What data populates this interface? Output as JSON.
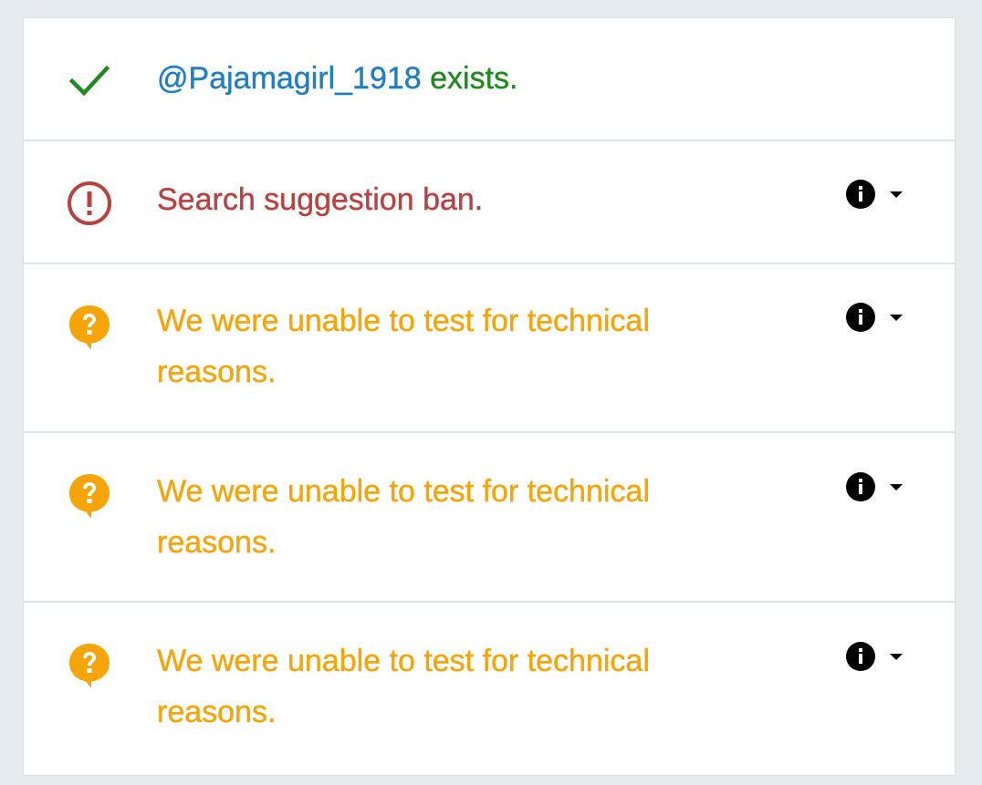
{
  "colors": {
    "success": "#1f8a1f",
    "handle": "#1f7fc0",
    "error": "#b94141",
    "warning": "#f5a40a"
  },
  "rows": [
    {
      "status": "success",
      "icon": "check-icon",
      "handle": "@Pajamagirl_1918",
      "message": " exists."
    },
    {
      "status": "error",
      "icon": "alert-circle-icon",
      "message": "Search suggestion ban.",
      "has_info": true
    },
    {
      "status": "warning",
      "icon": "help-bubble-icon",
      "message": "We were unable to test for technical reasons.",
      "has_info": true
    },
    {
      "status": "warning",
      "icon": "help-bubble-icon",
      "message": "We were unable to test for technical reasons.",
      "has_info": true
    },
    {
      "status": "warning",
      "icon": "help-bubble-icon",
      "message": "We were unable to test for technical reasons.",
      "has_info": true
    }
  ]
}
